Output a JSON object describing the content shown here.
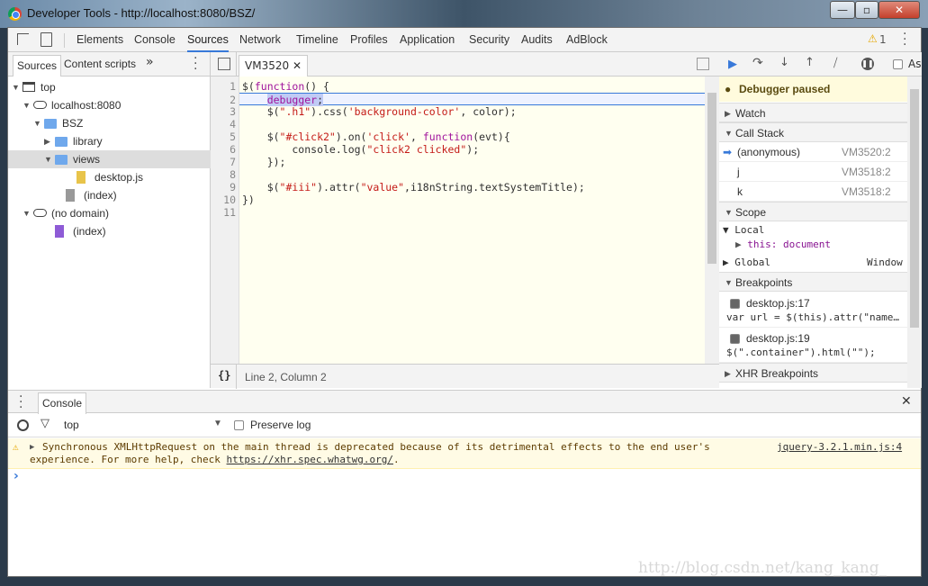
{
  "window": {
    "title": "Developer Tools - http://localhost:8080/BSZ/",
    "minimize": "—",
    "restore": "▫",
    "close": "✕"
  },
  "main_tabs": [
    "Elements",
    "Console",
    "Sources",
    "Network",
    "Timeline",
    "Profiles",
    "Application",
    "Security",
    "Audits",
    "AdBlock"
  ],
  "active_tab": "Sources",
  "warning_count": "1",
  "navigator": {
    "tabs": [
      "Sources",
      "Content scripts"
    ],
    "more": "»",
    "tree": [
      {
        "label": "top",
        "icon": "frame-icon",
        "level": 0,
        "arrow": "▼"
      },
      {
        "label": "localhost:8080",
        "icon": "cloud-icon",
        "level": 1,
        "arrow": "▼"
      },
      {
        "label": "BSZ",
        "icon": "folder-icon",
        "level": 2,
        "arrow": "▼"
      },
      {
        "label": "library",
        "icon": "folder-icon",
        "level": 3,
        "arrow": "▶"
      },
      {
        "label": "views",
        "icon": "folder-icon",
        "level": 3,
        "arrow": "▼",
        "selected": true
      },
      {
        "label": "desktop.js",
        "icon": "js-file-icon",
        "level": 5,
        "arrow": ""
      },
      {
        "label": "(index)",
        "icon": "document-icon",
        "level": 4,
        "arrow": ""
      },
      {
        "label": "(no domain)",
        "icon": "cloud-icon",
        "level": 1,
        "arrow": "▼"
      },
      {
        "label": "(index)",
        "icon": "document-icon",
        "level": 3,
        "arrow": "",
        "color": "#8e5bd6"
      }
    ]
  },
  "editor": {
    "tab": "VM3520",
    "status": "Line 2, Column 2",
    "format_icon": "{}",
    "lines": [
      "$(<k>function</k>() {",
      "    <k>debugger</k>;",
      "    $(<s>\".h1\"</s>).css(<s>'background-color'</s>, color);",
      "",
      "    $(<s>\"#click2\"</s>).on(<s>'click'</s>, <k>function</k>(evt){",
      "        console.log(<s>\"click2 clicked\"</s>);",
      "    });",
      "",
      "    $(<s>\"#iii\"</s>).attr(<s>\"value\"</s>,i18nString.textSystemTitle);",
      "})",
      ""
    ],
    "current_line": 2
  },
  "debugger": {
    "paused": "Debugger paused",
    "async_label": "Async",
    "watch": "Watch",
    "call_stack": "Call Stack",
    "frames": [
      {
        "name": "(anonymous)",
        "loc": "VM3520:2",
        "current": true
      },
      {
        "name": "j",
        "loc": "VM3518:2"
      },
      {
        "name": "k",
        "loc": "VM3518:2"
      }
    ],
    "scope": "Scope",
    "local": "Local",
    "this_key": "this",
    "this_val": "document",
    "global": "Global",
    "global_val": "Window",
    "breakpoints": "Breakpoints",
    "bps": [
      {
        "file": "desktop.js:17",
        "code": "var url = $(this).attr(\"name…",
        "checked": true
      },
      {
        "file": "desktop.js:19",
        "code": "$(\".container\").html(\"\");",
        "checked": true
      }
    ],
    "xhr": "XHR Breakpoints"
  },
  "console": {
    "tab": "Console",
    "context": "top",
    "preserve_log": "Preserve log",
    "message_line1": "Synchronous XMLHttpRequest on the main thread is deprecated because of its detrimental effects to the end user's",
    "message_line2_pre": "experience. For more help, check ",
    "message_link": "https://xhr.spec.whatwg.org/",
    "message_line2_post": ".",
    "source": "jquery-3.2.1.min.js:4",
    "prompt": "›"
  },
  "watermark": "http://blog.csdn.net/kang_kang_",
  "colors": {
    "accent": "#3879d9",
    "paused_bg": "#fffbdd",
    "warning_bg": "#fffbe5",
    "code_bg": "#fffff0"
  }
}
